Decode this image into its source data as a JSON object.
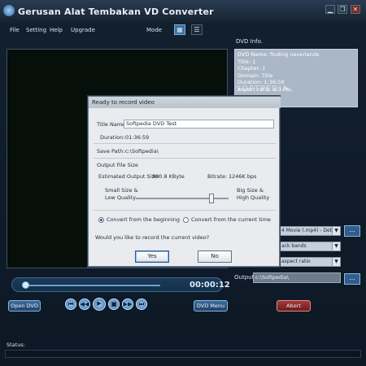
{
  "window": {
    "title": "Gerusan Alat Tembakan VD Converter",
    "minimize": "▁",
    "restore": "❐",
    "close": "✕"
  },
  "menu": [
    "File",
    "Setting",
    "Help",
    "Upgrade"
  ],
  "mode": {
    "label": "Mode",
    "icons": [
      "list-icon-grid",
      "list-icon-detail"
    ]
  },
  "dvd_info": {
    "label": "DVD Info.",
    "lines": [
      "DVD Name: finding neverlands",
      "Title: 1",
      "Chapter: 1",
      "Domain: Title",
      "Duration: 1:36:59",
      "Aspect ratio: 4:3    PAL"
    ]
  },
  "watermark": "SOFTPEDIA",
  "selects": [
    {
      "value": "4 Movie (.mp4) - Detai",
      "arrow": "▼"
    },
    {
      "value": "ack bands",
      "arrow": "▼"
    },
    {
      "value": "aspect ratio",
      "arrow": "▼"
    }
  ],
  "dots_label": "...",
  "output": {
    "label": "Output",
    "value": "c:\\Softpedia\\"
  },
  "seek": {
    "time": "00:00:12",
    "progress": 0.03
  },
  "buttons": {
    "open_dvd": "Open DVD",
    "dvd_menu": "DVD Menu",
    "abort": "Abort"
  },
  "transport": [
    "⏮",
    "◀◀",
    "▶",
    "■",
    "▶▶",
    "⏭"
  ],
  "status": "Status:",
  "dialog": {
    "title": "Ready to record video",
    "title_name_label": "Title Name:",
    "title_name_value": "Softpedia DVD Test",
    "duration_label": "Duration:",
    "duration_value": "01:36:59",
    "save_path_label": "Save Path:",
    "save_path_value": "c:\\Softpedia\\",
    "output_size_label": "Output File Size",
    "est_size_label": "Estimated Output Size:",
    "est_size_value": "890.8 KByte",
    "bitrate_label": "Bitrate:",
    "bitrate_value": "1246K bps",
    "small_label_1": "Small Size &",
    "small_label_2": "Low Quality",
    "big_label_1": "Big Size &",
    "big_label_2": "High Quality",
    "quality_level": 0.82,
    "convert_begin": "Convert from the beginning",
    "convert_current": "Convert from the current time",
    "question": "Would you like to record the current video?",
    "yes": "Yes",
    "no": "No"
  }
}
